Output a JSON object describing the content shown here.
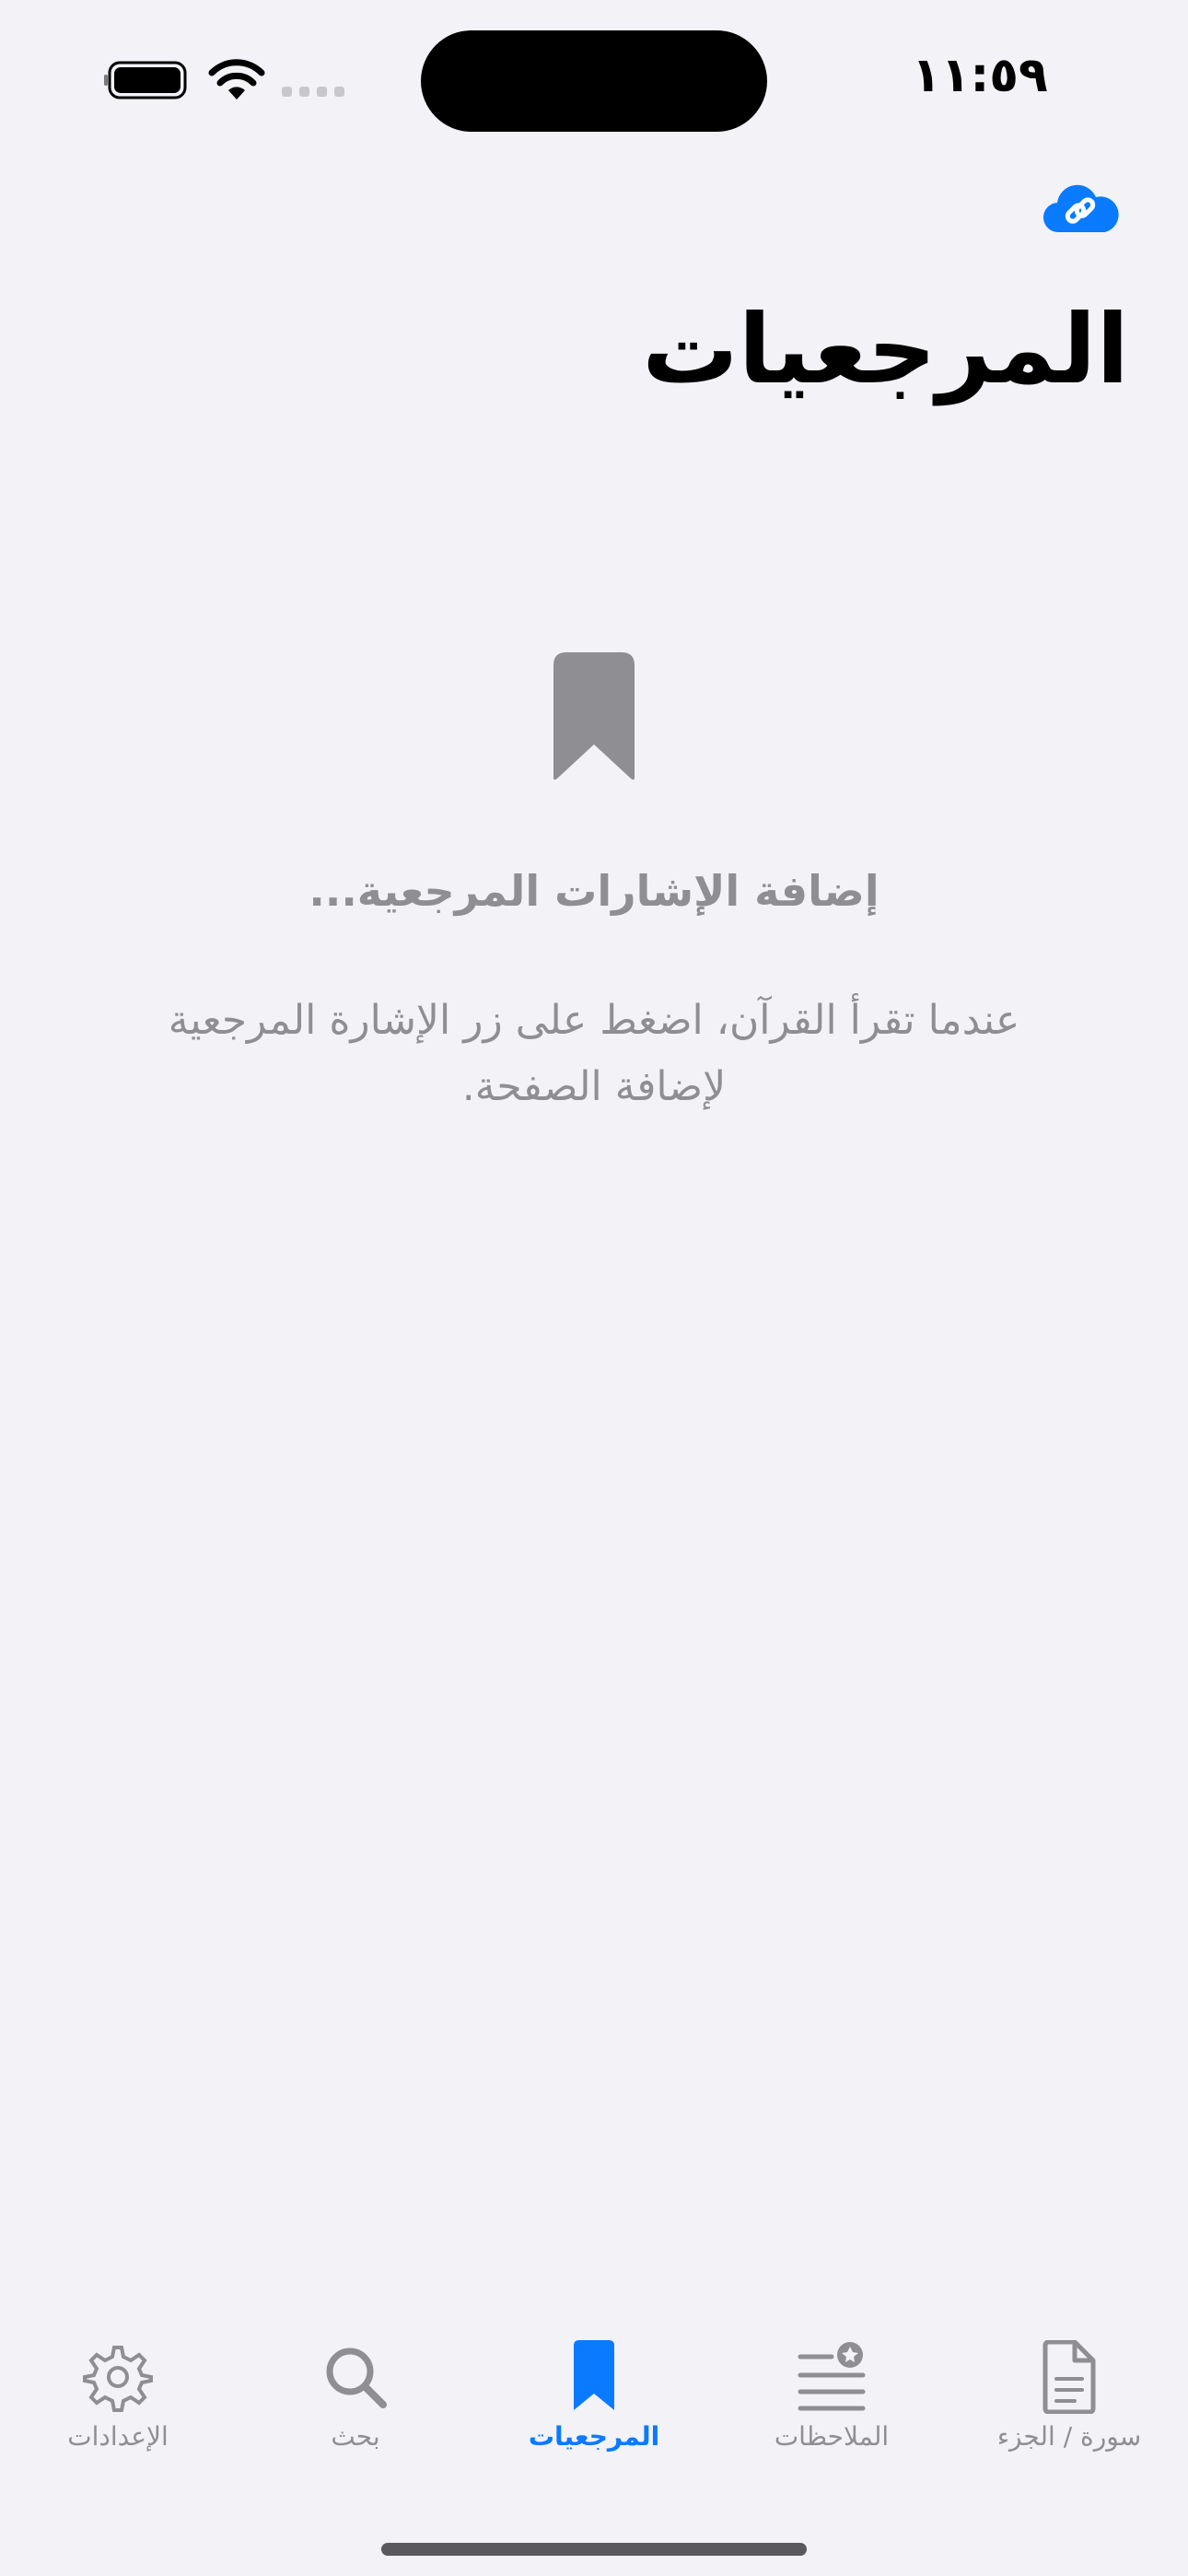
{
  "status_bar": {
    "time": "١١:٥٩"
  },
  "header": {
    "title": "المرجعيات"
  },
  "empty_state": {
    "title": "إضافة الإشارات المرجعية...",
    "body": "عندما تقرأ القرآن، اضغط على زر الإشارة المرجعية لإضافة الصفحة."
  },
  "tabs": [
    {
      "label": "سورة / الجزء",
      "icon": "document-icon"
    },
    {
      "label": "الملاحظات",
      "icon": "notes-star-icon"
    },
    {
      "label": "المرجعيات",
      "icon": "bookmark-icon",
      "active": true
    },
    {
      "label": "بحث",
      "icon": "search-icon"
    },
    {
      "label": "الإعدادات",
      "icon": "gear-icon"
    }
  ],
  "colors": {
    "accent": "#0A7AFF",
    "secondary": "#8E8E93",
    "background": "#F2F2F7"
  }
}
